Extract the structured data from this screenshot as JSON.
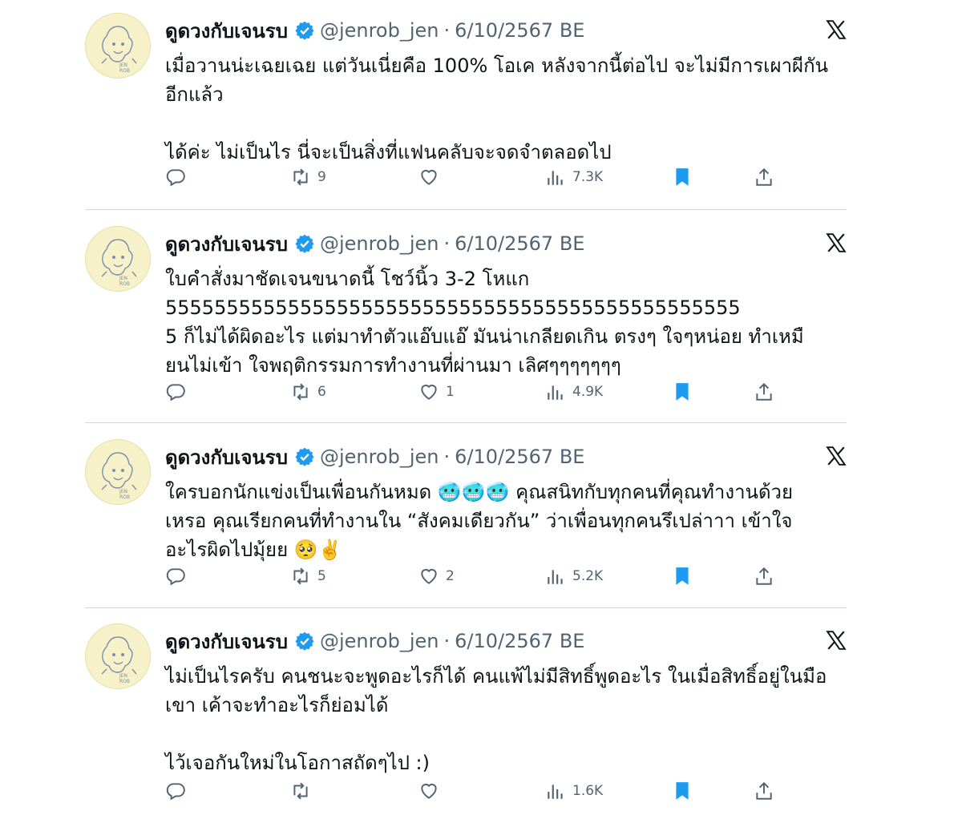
{
  "colors": {
    "accent": "#1d9bf0",
    "text": "#0f1419",
    "muted": "#536471",
    "bookmark": "#1d9bf0",
    "divider": "#cfd9de"
  },
  "icons": [
    "avatar-jenrob",
    "verified-badge-icon",
    "x-logo-icon",
    "reply-icon",
    "retweet-icon",
    "like-icon",
    "views-icon",
    "bookmark-icon",
    "share-icon"
  ],
  "tweets": [
    {
      "name": "ดูดวงกับเจนรบ",
      "handle": "@jenrob_jen",
      "dot": "·",
      "date": "6/10/2567 BE",
      "text": "เมื่อวานน่ะเฉยเฉย แต่วันเนี่ยคือ 100% โอเค หลังจากนี้ต่อไป จะไม่มีการเผาผีกัน\nอีกแล้ว\n\nได้ค่ะ ไม่เป็นไร นี่จะเป็นสิ่งที่แฟนคลับจะจดจำตลอดไป",
      "replies": "",
      "retweets": "9",
      "likes": "",
      "views": "7.3K"
    },
    {
      "name": "ดูดวงกับเจนรบ",
      "handle": "@jenrob_jen",
      "dot": "·",
      "date": "6/10/2567 BE",
      "text": "ใบคำสั่งมาชัดเจนขนาดนี้ โชว์นิ้ว 3-2 โหแก\n55555555555555555555555555555555555555555555555\n5 ก็ไม่ได้ผิดอะไร แต่มาทำตัวแอ๊บแอ๊ มันน่าเกลียดเกิน ตรงๆ ใจๆหน่อย ทำเหมื\nยนไม่เข้า ใจพฤติกรรมการทำงานที่ผ่านมา เลิศๆๆๆๆๆๆๆ",
      "replies": "",
      "retweets": "6",
      "likes": "1",
      "views": "4.9K"
    },
    {
      "name": "ดูดวงกับเจนรบ",
      "handle": "@jenrob_jen",
      "dot": "·",
      "date": "6/10/2567 BE",
      "text": "ใครบอกนักแข่งเป็นเพื่อนกันหมด 🥶🥶🥶 คุณสนิทกับทุกคนที่คุณทำงานด้วย\nเหรอ คุณเรียกคนที่ทำงานใน “สังคมเดียวกัน” ว่าเพื่อนทุกคนรึเปล่าาา เข้าใจ\nอะไรผิดไปมุ้ยย 🥺✌️",
      "replies": "",
      "retweets": "5",
      "likes": "2",
      "views": "5.2K"
    },
    {
      "name": "ดูดวงกับเจนรบ",
      "handle": "@jenrob_jen",
      "dot": "·",
      "date": "6/10/2567 BE",
      "text": "ไม่เป็นไรครับ คนชนะจะพูดอะไรก็ได้ คนแพ้ไม่มีสิทธิ์พูดอะไร ในเมื่อสิทธิ์อยู่ในมือ\nเขา เค้าจะทำอะไรก็ย่อมได้\n\nไว้เจอกันใหม่ในโอกาสถัดๆไป :)",
      "replies": "",
      "retweets": "",
      "likes": "",
      "views": "1.6K"
    }
  ]
}
